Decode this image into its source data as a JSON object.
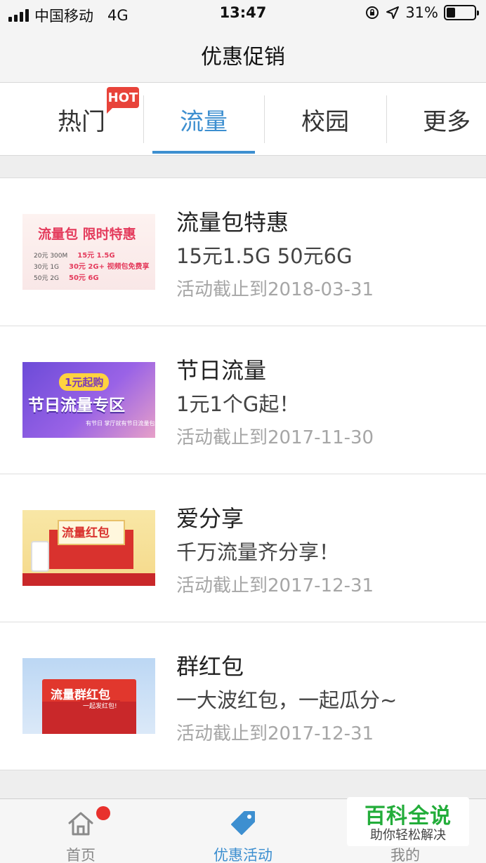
{
  "status_bar": {
    "carrier": "中国移动",
    "network": "4G",
    "time": "13:47",
    "battery_text": "31%",
    "battery_level": 0.31
  },
  "nav": {
    "title": "优惠促销"
  },
  "tabs": {
    "items": [
      {
        "label": "热门"
      },
      {
        "label": "流量"
      },
      {
        "label": "校园"
      },
      {
        "label": "更多"
      }
    ],
    "active_index": 1,
    "hot_badge": "HOT",
    "accent_color": "#3d8fd0"
  },
  "promos": [
    {
      "title": "流量包特惠",
      "desc": "15元1.5G 50元6G",
      "date": "活动截止到2018-03-31",
      "thumb": {
        "heading": "流量包 限时特惠",
        "rows": [
          {
            "left": "20元 300M",
            "right": "15元 1.5G"
          },
          {
            "left": "30元 1G",
            "right": "30元 2G+ 视频包免费享"
          },
          {
            "left": "50元 2G",
            "right": "50元 6G"
          }
        ]
      }
    },
    {
      "title": "节日流量",
      "desc": "1元1个G起！",
      "date": "活动截止到2017-11-30",
      "thumb": {
        "badge": "1元起购",
        "heading": "节日流量专区",
        "sub": "有节日 掌厅就有节日流量包"
      }
    },
    {
      "title": "爱分享",
      "desc": "千万流量齐分享！",
      "date": "活动截止到2017-12-31",
      "thumb": {
        "heading": "流量红包"
      }
    },
    {
      "title": "群红包",
      "desc": "一大波红包，一起瓜分~",
      "date": "活动截止到2017-12-31",
      "thumb": {
        "heading": "流量群红包",
        "sub": "一起发红包!"
      }
    }
  ],
  "tab_bar": {
    "items": [
      {
        "label": "首页",
        "icon": "home-icon"
      },
      {
        "label": "优惠活动",
        "icon": "tag-icon"
      },
      {
        "label": "我的",
        "icon": "user-icon"
      }
    ],
    "active_index": 1
  },
  "watermark": {
    "title": "百科全说",
    "subtitle": "助你轻松解决"
  }
}
